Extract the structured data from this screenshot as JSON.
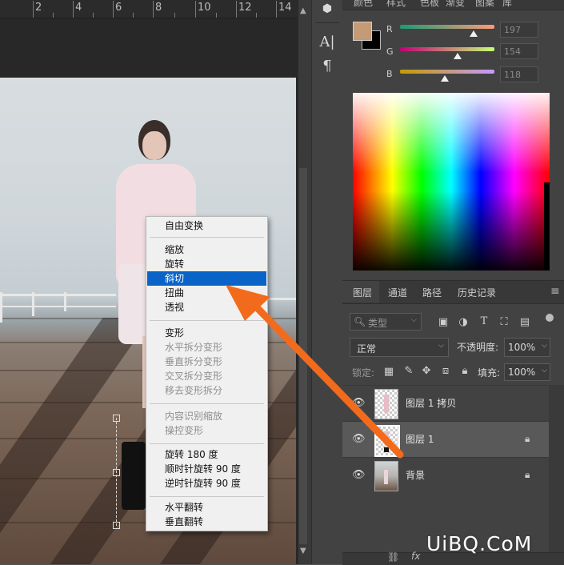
{
  "ruler": {
    "labels": [
      "2",
      "4",
      "6",
      "8",
      "10",
      "12",
      "14"
    ]
  },
  "tool_strip": {
    "icons": [
      "3d-cube-icon",
      "character-text-icon",
      "paragraph-icon"
    ],
    "glyph_A": "A|",
    "glyph_para": "¶"
  },
  "color_panel": {
    "tabs": [
      "颜色",
      "样式",
      "色板",
      "渐变",
      "图案",
      "库"
    ],
    "foreground": "#c59a76",
    "background": "#000000",
    "sliders": [
      {
        "label": "R",
        "value": "197"
      },
      {
        "label": "G",
        "value": "154"
      },
      {
        "label": "B",
        "value": "118"
      }
    ]
  },
  "layers_panel": {
    "tabs": [
      "图层",
      "通道",
      "路径",
      "历史记录"
    ],
    "kind_filter": "类型",
    "blend_mode": "正常",
    "opacity_label": "不透明度:",
    "opacity_value": "100%",
    "lock_label": "锁定:",
    "fill_label": "填充:",
    "fill_value": "100%",
    "layers": [
      {
        "name": "图层 1 拷贝",
        "locked": false
      },
      {
        "name": "图层 1",
        "locked": true,
        "selected": true
      },
      {
        "name": "背景",
        "locked": true
      }
    ],
    "bottom_icons": [
      "link-icon",
      "fx-icon"
    ],
    "fx_label": "fx"
  },
  "context_menu": {
    "items": [
      {
        "label": "自由变换",
        "enabled": true
      },
      {
        "separator": true
      },
      {
        "label": "缩放",
        "enabled": true
      },
      {
        "label": "旋转",
        "enabled": true
      },
      {
        "label": "斜切",
        "enabled": true,
        "highlighted": true
      },
      {
        "label": "扭曲",
        "enabled": true
      },
      {
        "label": "透视",
        "enabled": true
      },
      {
        "separator": true
      },
      {
        "label": "变形",
        "enabled": true
      },
      {
        "label": "水平拆分变形",
        "enabled": false
      },
      {
        "label": "垂直拆分变形",
        "enabled": false
      },
      {
        "label": "交叉拆分变形",
        "enabled": false
      },
      {
        "label": "移去变形拆分",
        "enabled": false
      },
      {
        "separator": true
      },
      {
        "label": "内容识别缩放",
        "enabled": false
      },
      {
        "label": "操控变形",
        "enabled": false
      },
      {
        "separator": true
      },
      {
        "label": "旋转 180 度",
        "enabled": true
      },
      {
        "label": "顺时针旋转 90 度",
        "enabled": true
      },
      {
        "label": "逆时针旋转 90 度",
        "enabled": true
      },
      {
        "separator": true
      },
      {
        "label": "水平翻转",
        "enabled": true
      },
      {
        "label": "垂直翻转",
        "enabled": true
      }
    ]
  },
  "annotation": {
    "arrow_color": "#f26b1d"
  },
  "watermark": {
    "text": "UiBQ.CoM"
  }
}
